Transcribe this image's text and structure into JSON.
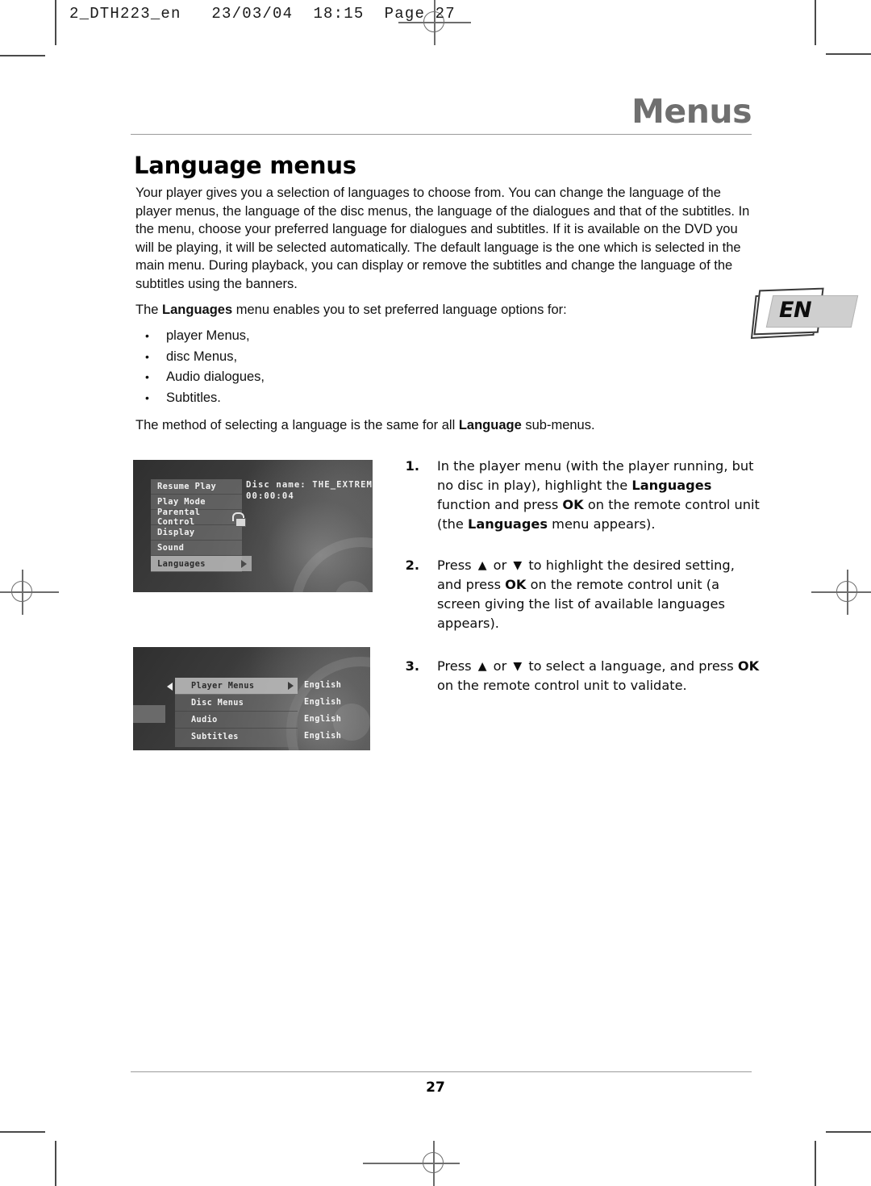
{
  "print_header": "2_DTH223_en   23/03/04  18:15  Page 27",
  "chapter_title": "Menus",
  "section_title": "Language menus",
  "intro_paragraph": "Your player gives you a selection of languages to choose from. You can change the language of the player menus, the language of the disc menus, the language of the dialogues and that of the subtitles. In the menu, choose your preferred language for dialogues and subtitles. If it is available on the DVD you will be playing, it will be selected automatically. The default language is the one which is selected in the main menu. During playback, you can display or remove the subtitles and change the language of the subtitles using the banners.",
  "lead_in": {
    "before": "The ",
    "bold": "Languages",
    "after": " menu enables you to set preferred language options for:"
  },
  "bullets": [
    "player Menus,",
    "disc Menus,",
    "Audio dialogues,",
    "Subtitles."
  ],
  "method_note": {
    "before": "The method of selecting a language is the same for all ",
    "bold": "Language",
    "after": " sub-menus."
  },
  "language_badge": {
    "label": "EN"
  },
  "screenshot_player_menu": {
    "disc_name_line": "Disc name: THE_EXTREM",
    "time_code": "00:00:04",
    "items": [
      {
        "label": "Resume Play",
        "selected": false
      },
      {
        "label": "Play Mode",
        "selected": false
      },
      {
        "label": "Parental Control",
        "selected": false
      },
      {
        "label": "Display",
        "selected": false
      },
      {
        "label": "Sound",
        "selected": false
      },
      {
        "label": "Languages",
        "selected": true
      }
    ]
  },
  "screenshot_languages_menu": {
    "rows": [
      {
        "label": "Player Menus",
        "value": "English",
        "selected": true
      },
      {
        "label": "Disc Menus",
        "value": "English",
        "selected": false
      },
      {
        "label": "Audio",
        "value": "English",
        "selected": false
      },
      {
        "label": "Subtitles",
        "value": "English",
        "selected": false
      }
    ]
  },
  "steps": [
    {
      "number": "1.",
      "parts": [
        {
          "t": "In the player menu (with the player running, but no disc in play), highlight the ",
          "b": false
        },
        {
          "t": "Languages",
          "b": true
        },
        {
          "t": " function and press ",
          "b": false
        },
        {
          "t": "OK",
          "b": true
        },
        {
          "t": " on the remote control unit (the ",
          "b": false
        },
        {
          "t": "Languages",
          "b": true
        },
        {
          "t": " menu appears).",
          "b": false
        }
      ]
    },
    {
      "number": "2.",
      "parts": [
        {
          "t": "Press ",
          "b": false
        },
        {
          "t": "▲",
          "b": false,
          "glyph": true
        },
        {
          "t": " or ",
          "b": false
        },
        {
          "t": "▼",
          "b": false,
          "glyph": true
        },
        {
          "t": " to highlight the desired setting, and press ",
          "b": false
        },
        {
          "t": "OK",
          "b": true
        },
        {
          "t": " on the remote control unit (a screen giving the list of available languages appears).",
          "b": false
        }
      ]
    },
    {
      "number": "3.",
      "parts": [
        {
          "t": "Press ",
          "b": false
        },
        {
          "t": "▲",
          "b": false,
          "glyph": true
        },
        {
          "t": " or ",
          "b": false
        },
        {
          "t": "▼",
          "b": false,
          "glyph": true
        },
        {
          "t": " to select a language, and press ",
          "b": false
        },
        {
          "t": "OK",
          "b": true
        },
        {
          "t": " on the remote control unit to validate.",
          "b": false
        }
      ]
    }
  ],
  "footer_page_number": "27",
  "colors": {
    "chapter_title": "#6f6f6f",
    "rule": "#9b9b9b",
    "badge_tab": "#cfcfcf",
    "screenshot_bg": "#3c3c3c"
  }
}
